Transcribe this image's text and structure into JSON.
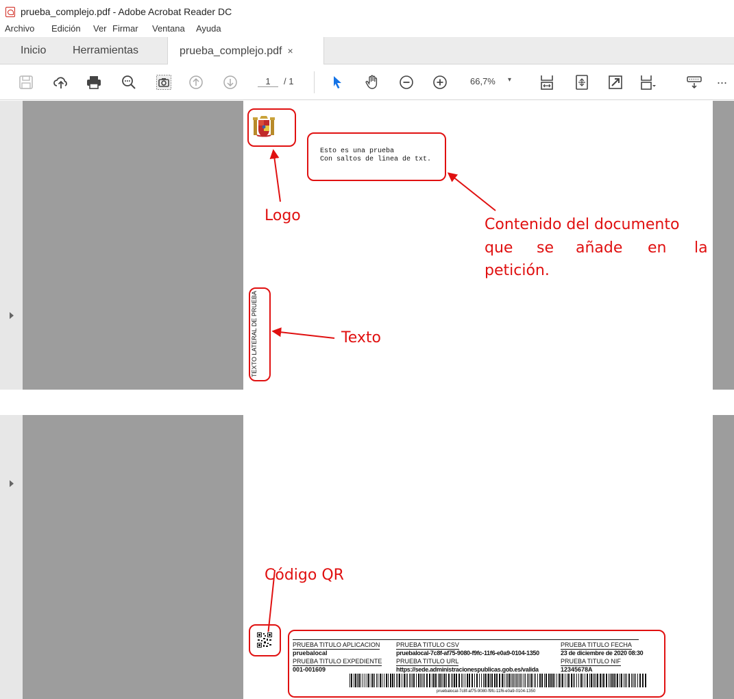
{
  "window": {
    "title": "prueba_complejo.pdf - Adobe Acrobat Reader DC"
  },
  "menu": [
    "Archivo",
    "Edición",
    "Ver",
    "Firmar",
    "Ventana",
    "Ayuda"
  ],
  "tabs": {
    "home": "Inicio",
    "tools": "Herramientas",
    "document": "prueba_complejo.pdf",
    "close": "×"
  },
  "toolbar": {
    "page_current": "1",
    "page_total": "/ 1",
    "zoom": "66,7%",
    "zoom_caret": "▾",
    "more": "..."
  },
  "document": {
    "body_line1": "Esto es una prueba",
    "body_line2": "Con saltos de linea de txt.",
    "side_text": "TEXTO LATERAL DE PRUEBA",
    "footer": {
      "app_title": "PRUEBA TITULO APLICACION",
      "app_value": "pruebalocal",
      "csv_title": "PRUEBA TITULO CSV",
      "csv_value": "pruebalocal-7c8f-af75-9080-f9fc-11f6-e0a9-0104-1350",
      "date_title": "PRUEBA TITULO FECHA",
      "date_value": "23 de diciembre de 2020 08:30",
      "exp_title": "PRUEBA TITULO EXPEDIENTE",
      "exp_value": "001-001609",
      "url_title": "PRUEBA TITULO URL",
      "url_value": "https://sede.administracionespublicas.gob.es/valida",
      "nif_title": "PRUEBA TITULO NIF",
      "nif_value": "12345678A",
      "barcode_caption": "pruebalocal-7c8f-af75-9080-f9fc-11f6-e0a9-0104-1350"
    }
  },
  "annotations": {
    "logo": "Logo",
    "content_line1": "Contenido del documento",
    "content_line2a": "que",
    "content_line2b": "se",
    "content_line2c": "añade",
    "content_line2d": "en",
    "content_line2e": "la",
    "content_line3": "petición.",
    "text": "Texto",
    "qr": "Código QR"
  },
  "colors": {
    "annotation": "#e01010",
    "gray_bg": "#9d9d9d",
    "accent_blue": "#1473e6"
  }
}
